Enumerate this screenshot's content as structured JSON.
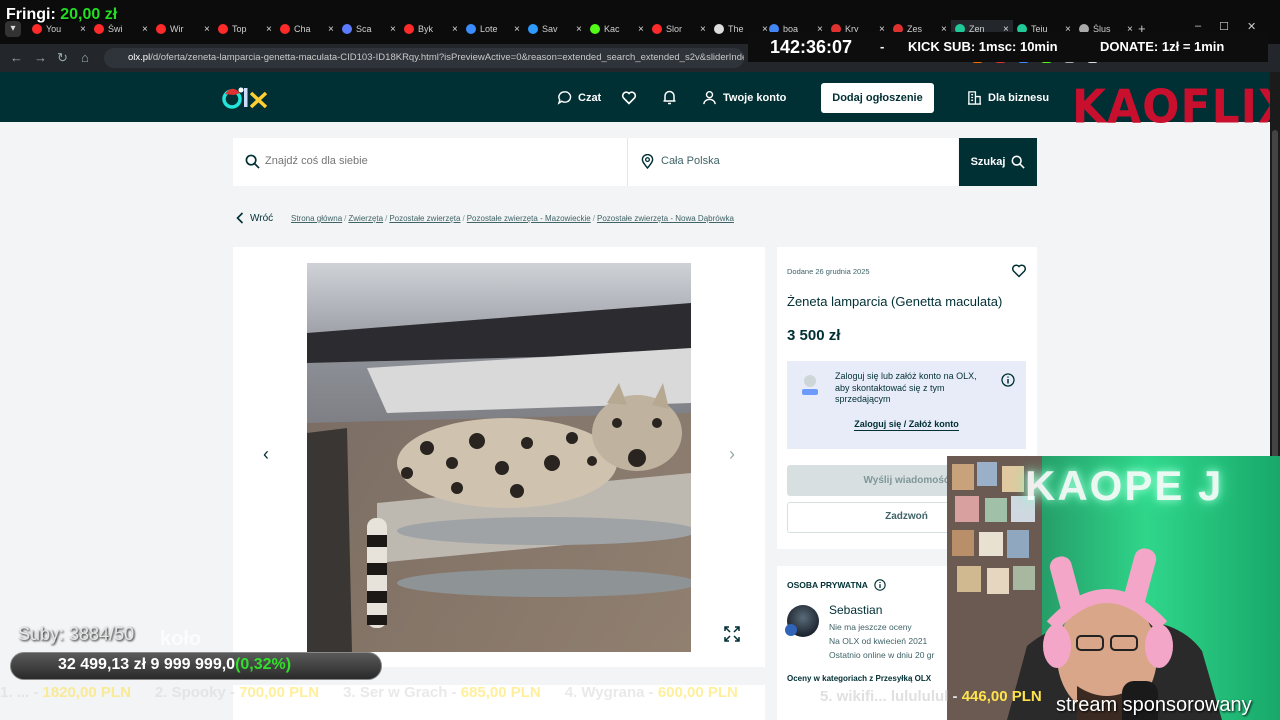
{
  "overlay": {
    "fringi_label": "Fringi:",
    "fringi_amount": "20,00 zł",
    "timer": "142:36:07",
    "timer_sep": "-",
    "kick_sub": "KICK SUB: 1msc: 10min",
    "donate": "DONATE: 1zł = 1min",
    "subs": "Suby: 3884/50",
    "kolo": "koło",
    "goal_current": "32 499,13 zł",
    "goal_target": "9 999 999,0",
    "goal_pct": "(0,32%)",
    "ticker": [
      {
        "label": "1. ... -",
        "amount": "1820,00 PLN"
      },
      {
        "label": "2. Spooky -",
        "amount": "700,00 PLN"
      },
      {
        "label": "3. Ser w Grach -",
        "amount": "685,00 PLN"
      },
      {
        "label": "4. Wygrana -",
        "amount": "600,00 PLN"
      }
    ],
    "ticker_live_label": "5. wikifi... lulululul -",
    "ticker_live_amount": "446,00 PLN",
    "sponsor": "stream sponsorowany",
    "webcam_neon": "KAOPE J",
    "kaoflix": "KAOFLIX"
  },
  "browser": {
    "tabs": [
      {
        "title": "You",
        "color": "#ff2a2a"
      },
      {
        "title": "Świ",
        "color": "#ff2a2a"
      },
      {
        "title": "Wir",
        "color": "#ff2a2a"
      },
      {
        "title": "Top",
        "color": "#ff2a2a"
      },
      {
        "title": "Cha",
        "color": "#ff2a2a"
      },
      {
        "title": "Sca",
        "color": "#5b7cff"
      },
      {
        "title": "Byk",
        "color": "#ff2a2a"
      },
      {
        "title": "Lote",
        "color": "#3a8cff"
      },
      {
        "title": "Sav",
        "color": "#2e9bff"
      },
      {
        "title": "Kac",
        "color": "#53fc18"
      },
      {
        "title": "Slor",
        "color": "#ff2a2a"
      },
      {
        "title": "The",
        "color": "#dddddd"
      }
    ],
    "tabs_right": [
      {
        "title": "boa",
        "color": "#4285f4"
      },
      {
        "title": "Kry",
        "color": "#e03131"
      },
      {
        "title": "Zes",
        "color": "#e03131"
      },
      {
        "title": "Zen",
        "color": "#20c997"
      },
      {
        "title": "Teju",
        "color": "#20c997"
      },
      {
        "title": "Ślus",
        "color": "#aaaaaa"
      }
    ],
    "active_tab_title": "Zen",
    "new_tab": "+",
    "url_site": "olx.pl",
    "url_path": "/d/oferta/zeneta-lamparcia-genetta-maculata-CID103-ID18KRqy.html?isPreviewActive=0&reason=extended_search_extended_s2v&sliderIndex=",
    "extension_colors": [
      "#ff6a00",
      "#e03131",
      "#3a8cff",
      "#53fc18",
      "#aaaaaa",
      "#dddddd"
    ]
  },
  "header": {
    "chat": "Czat",
    "account": "Twoje konto",
    "add_listing": "Dodaj ogłoszenie",
    "business": "Dla biznesu"
  },
  "search": {
    "placeholder": "Znajdź coś dla siebie",
    "location": "Cała Polska",
    "button": "Szukaj"
  },
  "breadcrumb": {
    "back": "Wróć",
    "items": [
      "Strona główna",
      "Zwierzęta",
      "Pozostałe zwierzęta",
      "Pozostałe zwierzęta - Mazowieckie",
      "Pozostałe zwierzęta - Nowa Dąbrówka"
    ]
  },
  "listing": {
    "posted": "Dodane 26 grudnia 2025",
    "title": "Żeneta lamparcia (Genetta maculata)",
    "price": "3 500 zł",
    "login_text": "Zaloguj się lub załóż konto na OLX, aby skontaktować się z tym sprzedającym",
    "login_link": "Zaloguj się / Załóż konto",
    "message_button": "Wyślij wiadomość",
    "call_button": "Zadzwoń"
  },
  "seller": {
    "type": "OSOBA PRYWATNA",
    "name": "Sebastian",
    "rating": "Nie ma jeszcze oceny",
    "since": "Na OLX od kwiecień 2021",
    "online": "Ostatnio online w dniu 20 gr",
    "categories": "Oceny w kategoriach z Przesyłką OLX"
  },
  "colors": {
    "olx_dark": "#002f34",
    "brand_red": "#c8102e",
    "goal_green": "#31e02a",
    "ticker_yellow": "#ffe34d"
  }
}
